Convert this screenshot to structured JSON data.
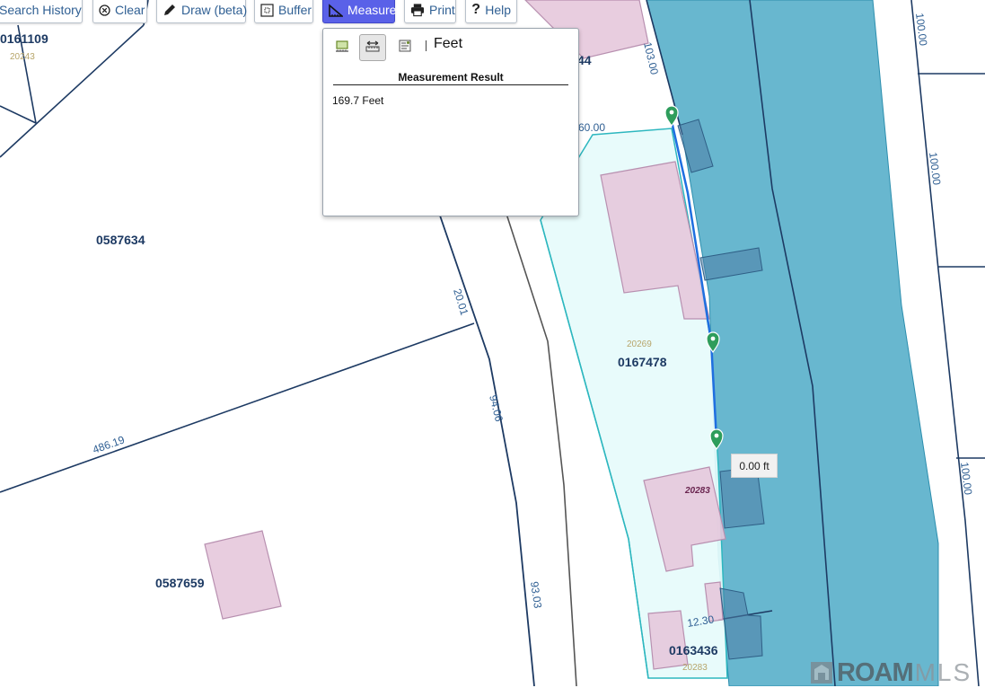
{
  "toolbar": {
    "search_history": "Search History",
    "clear": "Clear",
    "draw": "Draw (beta)",
    "buffer": "Buffer",
    "measure": "Measure",
    "print": "Print",
    "help": "Help",
    "active_tool": "Measure"
  },
  "measure_panel": {
    "unit": "Feet",
    "result_title": "Measurement Result",
    "result_value": "169.7 Feet",
    "active_mode": "distance"
  },
  "tooltip": {
    "text": "0.00 ft"
  },
  "map": {
    "parcels": {
      "p0161109": "0161109",
      "p0587634": "0587634",
      "p0167478": "0167478",
      "p0587659": "0587659",
      "p0163436": "0163436",
      "partial_44": "44"
    },
    "addresses": {
      "a20243": "20243",
      "a20269": "20269",
      "a20283_building": "20283",
      "a20283_bottom": "20283"
    },
    "dimensions": {
      "d103": "103.00",
      "d60": "60.00",
      "d100_a": "100.00",
      "d100_b": "100.00",
      "d100_c": "100.00",
      "d20": "20.01",
      "d94": "94.06",
      "d486": "486.19",
      "d93": "93.03",
      "d12": "12.30"
    },
    "colors": {
      "water": "#3ea3c1",
      "selected_parcel": "#e6fbfb",
      "building": "#e6c8dc",
      "parcel_line": "#1d3a63",
      "measure_line": "#1f6fe0",
      "marker": "#2e9d5c"
    }
  },
  "branding": {
    "roam": "ROAM",
    "mls": "MLS"
  }
}
